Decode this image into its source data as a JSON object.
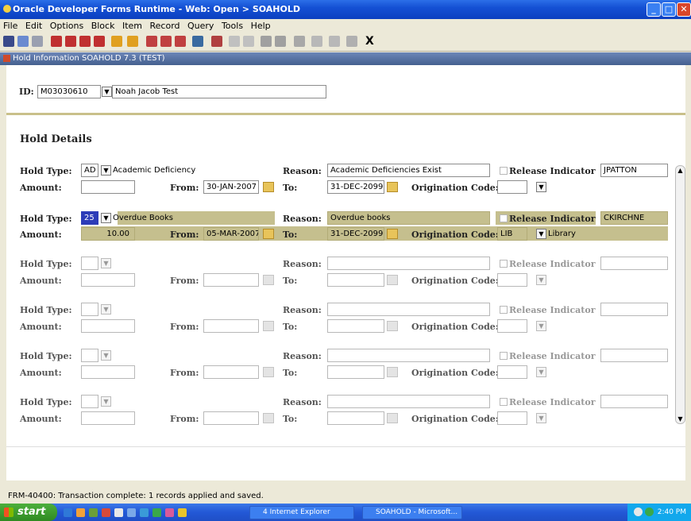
{
  "window": {
    "title": "Oracle Developer Forms Runtime - Web: Open > SOAHOLD"
  },
  "menu": [
    "File",
    "Edit",
    "Options",
    "Block",
    "Item",
    "Record",
    "Query",
    "Tools",
    "Help"
  ],
  "toolbar": {
    "exit_label": "X"
  },
  "form": {
    "title": "Hold Information  SOAHOLD  7.3  (TEST)"
  },
  "key": {
    "id_label": "ID:",
    "id_value": "M03030610",
    "name_value": "Noah Jacob Test"
  },
  "section": {
    "title": "Hold Details"
  },
  "labels": {
    "hold_type": "Hold Type:",
    "amount": "Amount:",
    "from": "From:",
    "reason": "Reason:",
    "to": "To:",
    "origination": "Origination Code:",
    "release": "Release Indicator"
  },
  "holds": [
    {
      "hold_type": "AD",
      "hold_desc": "Academic Deficiency",
      "amount": "",
      "from": "30-JAN-2007",
      "reason": "Academic Deficiencies Exist",
      "to": "31-DEC-2099",
      "orig_code": "",
      "orig_desc": "",
      "user": "JPATTON"
    },
    {
      "hold_type": "25",
      "hold_desc": "Overdue Books",
      "amount": "10.00",
      "from": "05-MAR-2007",
      "reason": "Overdue books",
      "to": "31-DEC-2099",
      "orig_code": "LIB",
      "orig_desc": "Library",
      "user": "CKIRCHNE"
    }
  ],
  "status": {
    "message": "FRM-40400: Transaction complete: 1 records applied and saved."
  },
  "taskbar": {
    "start": "start",
    "tasks": [
      "4 Internet Explorer",
      "SOAHOLD - Microsoft..."
    ],
    "clock": "2:40 PM"
  },
  "colors": {
    "selected_row": "#c5bf8e",
    "separator": "#c9c08a",
    "titlebar": "#1450d4"
  }
}
